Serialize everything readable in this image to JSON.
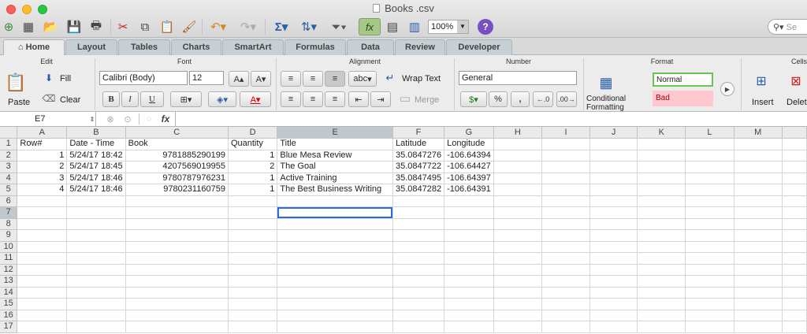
{
  "window": {
    "title": "Books .csv"
  },
  "toolbar": {
    "zoom": "100%",
    "search_placeholder": "Se"
  },
  "tabs": [
    {
      "label": "Home"
    },
    {
      "label": "Layout"
    },
    {
      "label": "Tables"
    },
    {
      "label": "Charts"
    },
    {
      "label": "SmartArt"
    },
    {
      "label": "Formulas"
    },
    {
      "label": "Data"
    },
    {
      "label": "Review"
    },
    {
      "label": "Developer"
    }
  ],
  "ribbon": {
    "groups": {
      "edit": "Edit",
      "font": "Font",
      "alignment": "Alignment",
      "number": "Number",
      "format": "Format",
      "cells": "Cells"
    },
    "paste": "Paste",
    "fill": "Fill",
    "clear": "Clear",
    "font_name": "Calibri (Body)",
    "font_size": "12",
    "bold": "B",
    "italic": "I",
    "underline": "U",
    "wrap_text": "Wrap Text",
    "merge": "Merge",
    "abc": "abc",
    "number_format": "General",
    "percent": "%",
    "comma": ",",
    "conditional_formatting": [
      "Conditional",
      "Formatting"
    ],
    "style_normal": "Normal",
    "style_bad": "Bad",
    "insert": "Insert",
    "delete": "Delet"
  },
  "formula_bar": {
    "name_box": "E7",
    "fx": "fx",
    "content": ""
  },
  "sheet": {
    "columns": [
      "A",
      "B",
      "C",
      "D",
      "E",
      "F",
      "G",
      "H",
      "I",
      "J",
      "K",
      "L",
      "M"
    ],
    "rows": [
      [
        "Row#",
        "Date - Time",
        "Book",
        "Quantity",
        "Title",
        "Latitude",
        "Longitude",
        "",
        "",
        "",
        "",
        "",
        ""
      ],
      [
        "1",
        "5/24/17 18:42",
        "9781885290199",
        "1",
        "Blue Mesa Review",
        "35.0847276",
        "-106.64394",
        "",
        "",
        "",
        "",
        "",
        ""
      ],
      [
        "2",
        "5/24/17 18:45",
        "4207569019955",
        "2",
        "The Goal",
        "35.0847722",
        "-106.64427",
        "",
        "",
        "",
        "",
        "",
        ""
      ],
      [
        "3",
        "5/24/17 18:46",
        "9780787976231",
        "1",
        "Active Training",
        "35.0847495",
        "-106.64397",
        "",
        "",
        "",
        "",
        "",
        ""
      ],
      [
        "4",
        "5/24/17 18:46",
        "9780231160759",
        "1",
        "The Best Business Writing",
        "35.0847282",
        "-106.64391",
        "",
        "",
        "",
        "",
        "",
        ""
      ]
    ],
    "row_count": 17,
    "selected_cell": "E7"
  },
  "colors": {
    "accent": "#2a6ce0",
    "bad_fill": "#ffc7ce",
    "normal_border": "#6ac258"
  }
}
